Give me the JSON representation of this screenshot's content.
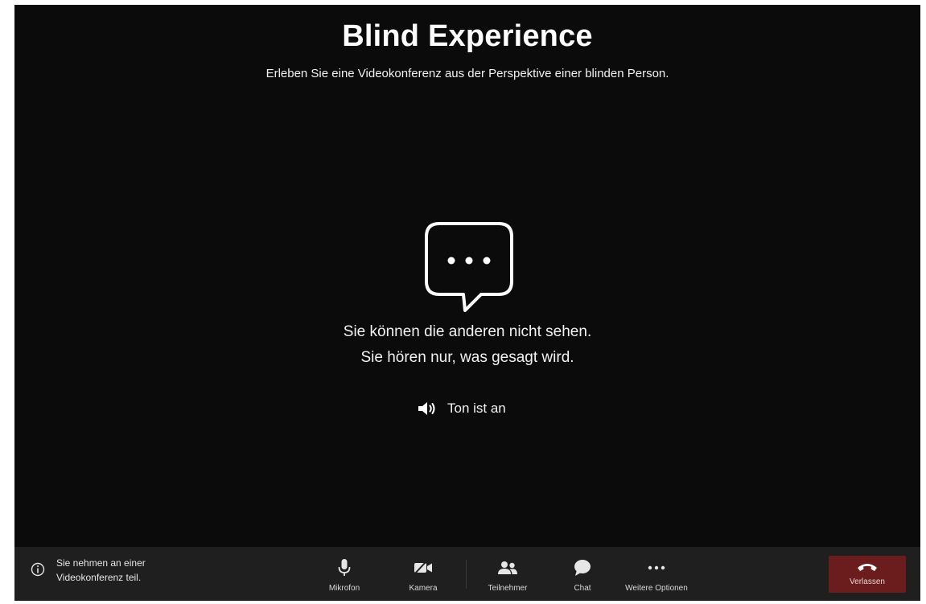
{
  "header": {
    "title": "Blind Experience",
    "subtitle": "Erleben Sie eine Videokonferenz aus der Perspektive einer blinden Person."
  },
  "center": {
    "icon": "chat-bubble-dots-icon",
    "line1": "Sie können die anderen nicht sehen.",
    "line2": "Sie hören nur, was gesagt wird.",
    "sound_status": "Ton ist an"
  },
  "toolbar": {
    "info_text_line1": "Sie nehmen an einer",
    "info_text_line2": "Videokonferenz teil.",
    "controls": [
      {
        "label": "Mikrofon",
        "icon": "microphone-icon"
      },
      {
        "label": "Kamera",
        "icon": "camera-icon"
      },
      {
        "label": "Teilnehmer",
        "icon": "participants-icon"
      },
      {
        "label": "Chat",
        "icon": "chat-icon"
      },
      {
        "label": "Weitere Optionen",
        "icon": "more-options-icon"
      }
    ],
    "leave_label": "Verlassen"
  },
  "colors": {
    "background": "#0b0b0b",
    "toolbar": "#1f1f1f",
    "leave_button": "#6b1c1c"
  }
}
